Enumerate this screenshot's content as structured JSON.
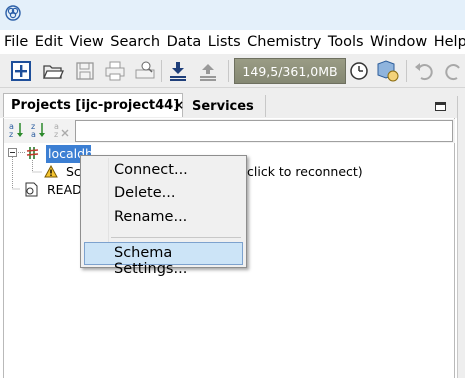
{
  "menu": [
    "File",
    "Edit",
    "View",
    "Search",
    "Data",
    "Lists",
    "Chemistry",
    "Tools",
    "Window",
    "Help"
  ],
  "toolbar": {
    "memory_label": "149,5/361,0MB"
  },
  "tabs": {
    "projects_label": "Projects [ijc-project44]",
    "close_glyph": "×",
    "services_label": "Services"
  },
  "filter": {
    "value": "",
    "placeholder": ""
  },
  "tree": {
    "root_label": "localdb",
    "child1_prefix": "Sc",
    "child1_suffix": "click to reconnect)",
    "child2_label": "READ"
  },
  "context_menu": {
    "items": [
      "Connect...",
      "Delete...",
      "Rename...",
      "Schema Settings..."
    ],
    "hovered_index": 3
  },
  "colors": {
    "selection": "#3c7fd3",
    "menu_hover": "#cce4f7",
    "memory_bg": "#858873"
  }
}
